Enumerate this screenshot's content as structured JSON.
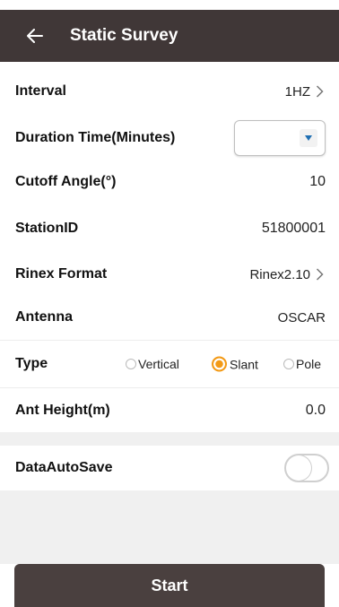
{
  "colors": {
    "header_bg": "#403737",
    "accent": "#f39a16",
    "gap_bg": "#f0f0f0",
    "button_bg": "#4a403f"
  },
  "header": {
    "title": "Static Survey",
    "back_icon": "arrow-left-icon"
  },
  "fields": {
    "interval": {
      "label": "Interval",
      "value": "1HZ"
    },
    "duration": {
      "label": "Duration Time(Minutes)",
      "value": ""
    },
    "cutoff": {
      "label": "Cutoff Angle(°)",
      "value": "10"
    },
    "station": {
      "label": "StationID",
      "value": "51800001"
    },
    "rinex": {
      "label": "Rinex Format",
      "value": "Rinex2.10"
    },
    "antenna": {
      "label": "Antenna",
      "value": "OSCAR"
    },
    "type": {
      "label": "Type",
      "options": [
        "Vertical",
        "Slant",
        "Pole"
      ],
      "selected": "Slant"
    },
    "height": {
      "label": "Ant Height(m)",
      "value": "0.0"
    },
    "autosave": {
      "label": "DataAutoSave",
      "enabled": false
    }
  },
  "actions": {
    "start_label": "Start"
  }
}
